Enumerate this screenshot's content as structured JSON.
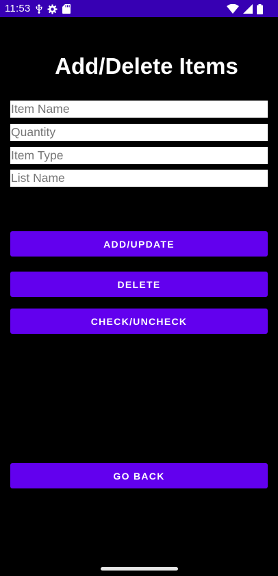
{
  "status_bar": {
    "time": "11:53",
    "background": "#3700b3",
    "left_icons": [
      "usb-debug-icon",
      "settings-gear-icon",
      "sd-card-icon"
    ],
    "right_icons": [
      "wifi-icon",
      "cellular-signal-icon",
      "battery-icon"
    ]
  },
  "title": "Add/Delete Items",
  "fields": {
    "item_name": {
      "placeholder": "Item Name",
      "value": ""
    },
    "quantity": {
      "placeholder": "Quantity",
      "value": ""
    },
    "item_type": {
      "placeholder": "Item Type",
      "value": ""
    },
    "list_name": {
      "placeholder": "List Name",
      "value": ""
    }
  },
  "buttons": {
    "add_update": "ADD/UPDATE",
    "delete": "DELETE",
    "check_uncheck": "CHECK/UNCHECK",
    "go_back": "GO BACK"
  },
  "colors": {
    "background": "#000000",
    "button": "#6200ee",
    "button_text": "#ffffff",
    "field_background": "#ffffff"
  }
}
